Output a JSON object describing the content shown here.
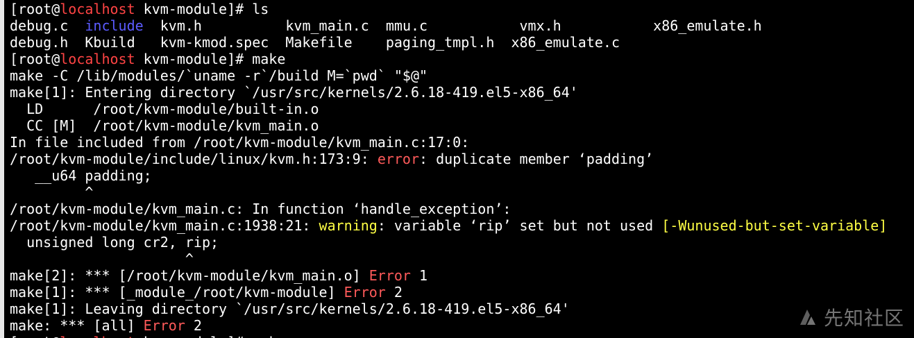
{
  "terminal": {
    "lines": [
      {
        "segments": [
          {
            "text": "[root@",
            "color": "default"
          },
          {
            "text": "localhost",
            "color": "host"
          },
          {
            "text": " kvm-module]# ls",
            "color": "default"
          }
        ]
      },
      {
        "segments": [
          {
            "text": "debug.c  ",
            "color": "default"
          },
          {
            "text": "include",
            "color": "dir"
          },
          {
            "text": "  kvm.h          kvm_main.c  mmu.c           vmx.h           x86_emulate.h",
            "color": "default"
          }
        ]
      },
      {
        "segments": [
          {
            "text": "debug.h  Kbuild   kvm-kmod.spec  Makefile    paging_tmpl.h  x86_emulate.c",
            "color": "default"
          }
        ]
      },
      {
        "segments": [
          {
            "text": "[root@",
            "color": "default"
          },
          {
            "text": "localhost",
            "color": "host"
          },
          {
            "text": " kvm-module]# make",
            "color": "default"
          }
        ]
      },
      {
        "segments": [
          {
            "text": "make -C /lib/modules/`uname -r`/build M=`pwd` \"$@\"",
            "color": "default"
          }
        ]
      },
      {
        "segments": [
          {
            "text": "make[1]: Entering directory `/usr/src/kernels/2.6.18-419.el5-x86_64'",
            "color": "default"
          }
        ]
      },
      {
        "segments": [
          {
            "text": "  LD      /root/kvm-module/built-in.o",
            "color": "default"
          }
        ]
      },
      {
        "segments": [
          {
            "text": "  CC [M]  /root/kvm-module/kvm_main.o",
            "color": "default"
          }
        ]
      },
      {
        "segments": [
          {
            "text": "In file included from /root/kvm-module/kvm_main.c:17:0:",
            "color": "default"
          }
        ]
      },
      {
        "segments": [
          {
            "text": "/root/kvm-module/include/linux/kvm.h:173:9: ",
            "color": "default"
          },
          {
            "text": "error",
            "color": "error"
          },
          {
            "text": ": duplicate member ‘padding’",
            "color": "default"
          }
        ]
      },
      {
        "segments": [
          {
            "text": "   __u64 padding;",
            "color": "default"
          }
        ]
      },
      {
        "segments": [
          {
            "text": "         ^",
            "color": "default"
          }
        ]
      },
      {
        "segments": [
          {
            "text": "/root/kvm-module/kvm_main.c: In function ‘handle_exception’:",
            "color": "default"
          }
        ]
      },
      {
        "segments": [
          {
            "text": "/root/kvm-module/kvm_main.c:1938:21: ",
            "color": "default"
          },
          {
            "text": "warning",
            "color": "warning"
          },
          {
            "text": ": variable ‘rip’ set but not used ",
            "color": "default"
          },
          {
            "text": "[-Wunused-but-set-variable]",
            "color": "flag"
          }
        ]
      },
      {
        "segments": [
          {
            "text": "  unsigned long cr2, rip;",
            "color": "default"
          }
        ]
      },
      {
        "segments": [
          {
            "text": "                     ^",
            "color": "default"
          }
        ]
      },
      {
        "segments": [
          {
            "text": "make[2]: *** [/root/kvm-module/kvm_main.o] ",
            "color": "default"
          },
          {
            "text": "Error",
            "color": "error"
          },
          {
            "text": " 1",
            "color": "default"
          }
        ]
      },
      {
        "segments": [
          {
            "text": "make[1]: *** [_module_/root/kvm-module] ",
            "color": "default"
          },
          {
            "text": "Error",
            "color": "error"
          },
          {
            "text": " 2",
            "color": "default"
          }
        ]
      },
      {
        "segments": [
          {
            "text": "make[1]: Leaving directory `/usr/src/kernels/2.6.18-419.el5-x86_64'",
            "color": "default"
          }
        ]
      },
      {
        "segments": [
          {
            "text": "make: *** [all] ",
            "color": "default"
          },
          {
            "text": "Error",
            "color": "error"
          },
          {
            "text": " 2",
            "color": "default"
          }
        ]
      },
      {
        "segments": [
          {
            "text": "[root@",
            "color": "default"
          },
          {
            "text": "localhost",
            "color": "host"
          },
          {
            "text": " kvm-module]# make",
            "color": "default"
          }
        ],
        "cut": true
      }
    ]
  },
  "watermark": {
    "text": "先知社区",
    "icon": "xianzhi-logo-icon"
  },
  "colors": {
    "background": "#000000",
    "default": "#ffffff",
    "host": "#ff4444",
    "dir": "#5b5bff",
    "error": "#ff5a5a",
    "warning": "#ffff44",
    "flag": "#ffff44"
  }
}
